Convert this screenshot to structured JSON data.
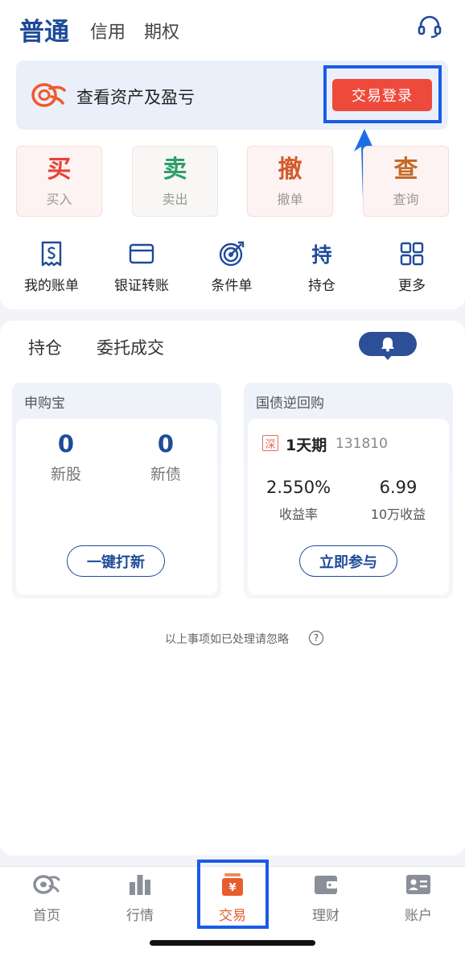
{
  "header": {
    "tab_active": "普通",
    "tab_credit": "信用",
    "tab_options": "期权",
    "support_icon": "headset-icon"
  },
  "asset_banner": {
    "text": "查看资产及盈亏",
    "login_label": "交易登录"
  },
  "trade_buttons": [
    {
      "big": "买",
      "small": "买入",
      "color": "#e84235"
    },
    {
      "big": "卖",
      "small": "卖出",
      "color": "#2ea06b"
    },
    {
      "big": "撤",
      "small": "撤单",
      "color": "#d35a2c"
    },
    {
      "big": "查",
      "small": "查询",
      "color": "#c46a28"
    }
  ],
  "shortcuts": [
    {
      "label": "我的账单",
      "icon": "bill-icon"
    },
    {
      "label": "银证转账",
      "icon": "card-icon"
    },
    {
      "label": "条件单",
      "icon": "target-icon"
    },
    {
      "label": "持仓",
      "icon": "hold-icon",
      "glyph": "持"
    },
    {
      "label": "更多",
      "icon": "grid-icon"
    }
  ],
  "position_tabs": {
    "holdings": "持仓",
    "orders": "委托成交"
  },
  "ipo_panel": {
    "title": "申购宝",
    "new_stock_count": "0",
    "new_stock_label": "新股",
    "new_bond_count": "0",
    "new_bond_label": "新债",
    "action_label": "一键打新"
  },
  "repo_panel": {
    "title": "国债逆回购",
    "market_tag": "深",
    "product_name": "1天期",
    "product_code": "131810",
    "yield_value": "2.550%",
    "yield_label": "收益率",
    "income_value": "6.99",
    "income_label": "10万收益",
    "action_label": "立即参与"
  },
  "note": {
    "text": "以上事项如已处理请忽略",
    "help_glyph": "?"
  },
  "bottom_nav": [
    {
      "label": "首页",
      "icon": "home-icon"
    },
    {
      "label": "行情",
      "icon": "chart-icon"
    },
    {
      "label": "交易",
      "icon": "trade-icon",
      "active": true
    },
    {
      "label": "理财",
      "icon": "wallet-icon"
    },
    {
      "label": "账户",
      "icon": "account-icon"
    }
  ],
  "colors": {
    "brand_blue": "#1f4b99",
    "accent_red": "#ee4a3c",
    "active_orange": "#e85d2e",
    "highlight": "#1a5be6"
  }
}
